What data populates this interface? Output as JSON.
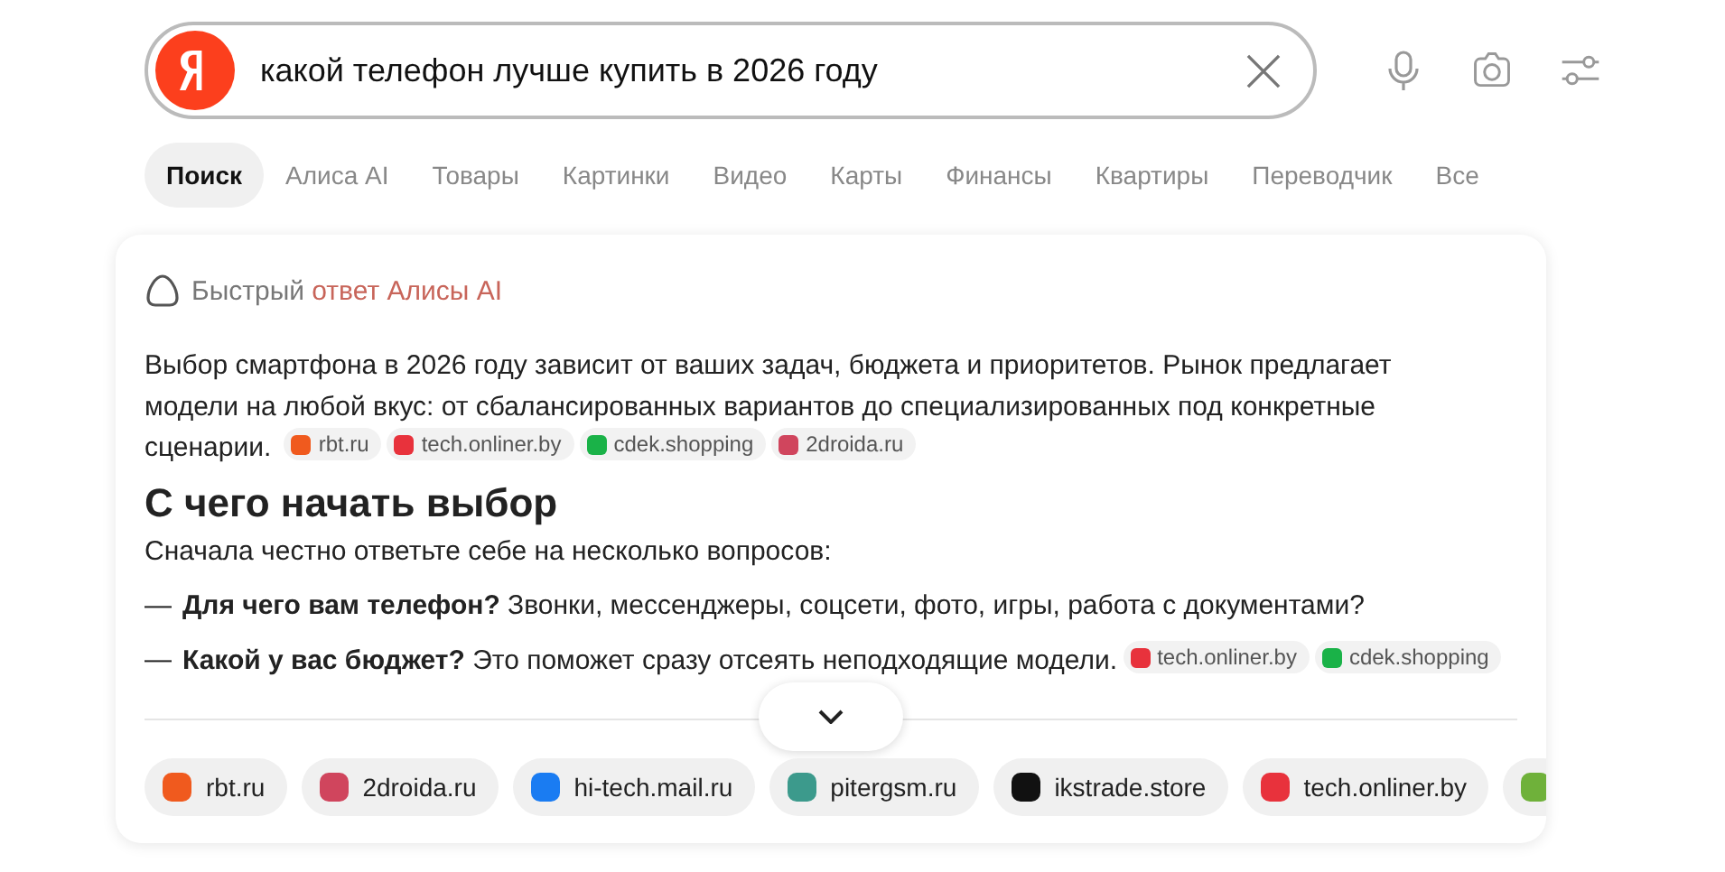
{
  "search": {
    "value": "какой телефон лучше купить в 2026 году"
  },
  "tabs": [
    {
      "label": "Поиск",
      "selected": true
    },
    {
      "label": "Алиса AI",
      "selected": false
    },
    {
      "label": "Товары",
      "selected": false
    },
    {
      "label": "Картинки",
      "selected": false
    },
    {
      "label": "Видео",
      "selected": false
    },
    {
      "label": "Карты",
      "selected": false
    },
    {
      "label": "Финансы",
      "selected": false
    },
    {
      "label": "Квартиры",
      "selected": false
    },
    {
      "label": "Переводчик",
      "selected": false
    },
    {
      "label": "Все",
      "selected": false
    }
  ],
  "answer": {
    "header_prefix": "Быстрый",
    "header_accent": "ответ Алисы AI",
    "intro": "Выбор смартфона в 2026 году зависит от ваших задач, бюджета и приоритетов. Рынок предлагает модели на любой вкус: от сбалансированных вариантов до специализированных под конкретные сценарии.",
    "intro_sources": [
      {
        "domain": "rbt.ru",
        "color": "#f05a1e"
      },
      {
        "domain": "tech.onliner.by",
        "color": "#e8323c"
      },
      {
        "domain": "cdek.shopping",
        "color": "#1ab248"
      },
      {
        "domain": "2droida.ru",
        "color": "#d0455d"
      }
    ],
    "heading": "С чего начать выбор",
    "lead": "Сначала честно ответьте себе на несколько вопросов:",
    "bullets": [
      {
        "dash": "—",
        "text": "**Для чего вам телефон?** Звонки, мессенджеры, соцсети, фото, игры, работа с документами?"
      },
      {
        "dash": "—",
        "text": "**Какой у вас бюджет?** Это поможет сразу отсеять неподходящие модели.",
        "sources": [
          {
            "domain": "tech.onliner.by",
            "color": "#e8323c"
          },
          {
            "domain": "cdek.shopping",
            "color": "#1ab248"
          }
        ]
      }
    ],
    "sources": [
      {
        "domain": "rbt.ru",
        "color": "#f05a1e"
      },
      {
        "domain": "2droida.ru",
        "color": "#d0455d"
      },
      {
        "domain": "hi-tech.mail.ru",
        "color": "#1a7cf2"
      },
      {
        "domain": "pitergsm.ru",
        "color": "#3c9a8c"
      },
      {
        "domain": "ikstrade.store",
        "color": "#111111"
      },
      {
        "domain": "tech.onliner.by",
        "color": "#e8323c"
      },
      {
        "color": "#6fb13a"
      }
    ]
  }
}
